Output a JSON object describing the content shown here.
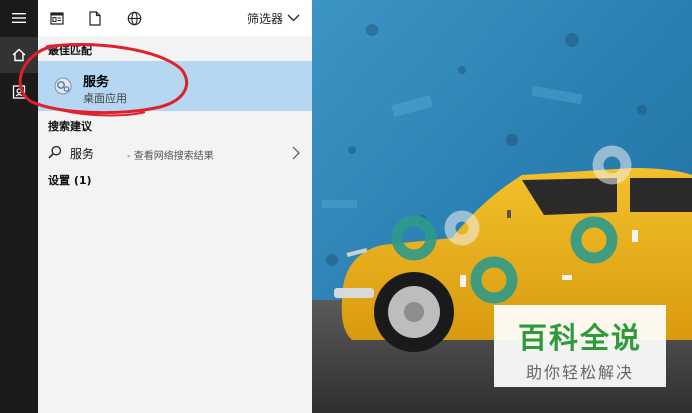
{
  "toolbar": {
    "filter_label": "筛选器"
  },
  "sections": {
    "best_match": "最佳匹配",
    "suggestions": "搜索建议",
    "settings": "设置 (1)"
  },
  "best_match": {
    "title": "服务",
    "subtitle": "桌面应用"
  },
  "suggestion": {
    "term": "服务",
    "description": "- 查看网络搜索结果"
  },
  "watermark": {
    "title": "百科全说",
    "subtitle": "助你轻松解决"
  },
  "icons": {
    "rail": [
      "hamburger-icon",
      "home-icon",
      "document-icon"
    ],
    "toolbar": [
      "app-window-icon",
      "file-icon",
      "globe-icon"
    ]
  },
  "colors": {
    "selection": "#b5d7f2",
    "annotation": "#e0202a",
    "watermark_green": "#2f9a3c",
    "rail_bg": "#1b1b1b"
  }
}
